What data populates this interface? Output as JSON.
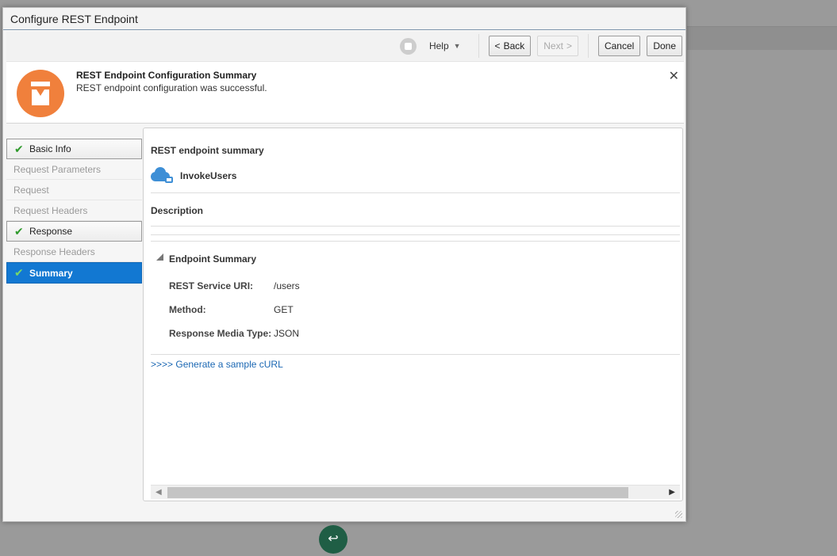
{
  "dialog": {
    "title": "Configure REST Endpoint"
  },
  "toolbar": {
    "help_label": "Help",
    "back_label": "Back",
    "next_label": "Next",
    "cancel_label": "Cancel",
    "done_label": "Done"
  },
  "banner": {
    "title": "REST Endpoint Configuration Summary",
    "message": "REST endpoint configuration was successful."
  },
  "nav": {
    "items": [
      {
        "label": "Basic Info",
        "state": "done"
      },
      {
        "label": "Request Parameters",
        "state": "disabled"
      },
      {
        "label": "Request",
        "state": "disabled"
      },
      {
        "label": "Request Headers",
        "state": "disabled"
      },
      {
        "label": "Response",
        "state": "done"
      },
      {
        "label": "Response Headers",
        "state": "disabled"
      },
      {
        "label": "Summary",
        "state": "active"
      }
    ]
  },
  "content": {
    "summary_heading": "REST endpoint summary",
    "endpoint_name": "InvokeUsers",
    "description_label": "Description",
    "endpoint_summary_label": "Endpoint Summary",
    "fields": [
      {
        "key": "REST Service URI:",
        "value": "/users"
      },
      {
        "key": "Method:",
        "value": "GET"
      },
      {
        "key": "Response Media Type:",
        "value": "JSON"
      }
    ],
    "curl_link": ">>>> Generate a sample cURL"
  },
  "colors": {
    "accent_blue": "#1278d2",
    "badge_orange": "#f0803c",
    "success_green": "#2f9a2c",
    "link_blue": "#1a67b3"
  }
}
